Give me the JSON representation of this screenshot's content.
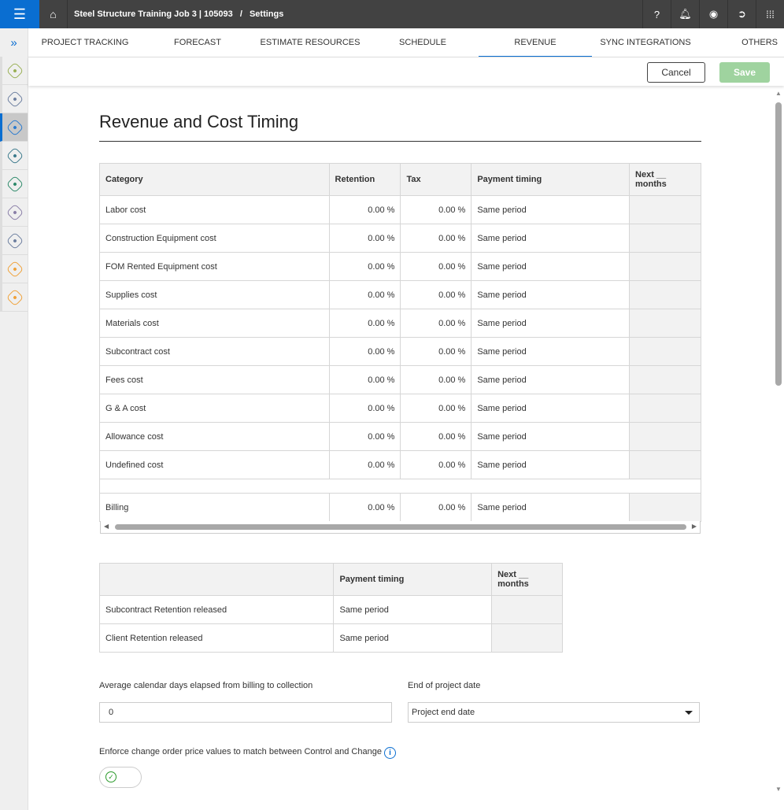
{
  "header": {
    "breadcrumb_project": "Steel Structure Training Job 3 | 105093",
    "breadcrumb_sep": "/",
    "breadcrumb_page": "Settings"
  },
  "tabs": [
    "PROJECT TRACKING",
    "FORECAST",
    "ESTIMATE RESOURCES",
    "SCHEDULE",
    "REVENUE",
    "SYNC INTEGRATIONS",
    "OTHERS"
  ],
  "toolbar": {
    "cancel": "Cancel",
    "save": "Save"
  },
  "page_title": "Revenue and Cost Timing",
  "table1": {
    "headers": [
      "Category",
      "Retention",
      "Tax",
      "Payment timing",
      "Next __ months"
    ],
    "rows": [
      [
        "Labor cost",
        "0.00 %",
        "0.00 %",
        "Same period"
      ],
      [
        "Construction Equipment cost",
        "0.00 %",
        "0.00 %",
        "Same period"
      ],
      [
        "FOM Rented Equipment cost",
        "0.00 %",
        "0.00 %",
        "Same period"
      ],
      [
        "Supplies cost",
        "0.00 %",
        "0.00 %",
        "Same period"
      ],
      [
        "Materials cost",
        "0.00 %",
        "0.00 %",
        "Same period"
      ],
      [
        "Subcontract cost",
        "0.00 %",
        "0.00 %",
        "Same period"
      ],
      [
        "Fees cost",
        "0.00 %",
        "0.00 %",
        "Same period"
      ],
      [
        "G & A cost",
        "0.00 %",
        "0.00 %",
        "Same period"
      ],
      [
        "Allowance cost",
        "0.00 %",
        "0.00 %",
        "Same period"
      ],
      [
        "Undefined cost",
        "0.00 %",
        "0.00 %",
        "Same period"
      ]
    ],
    "billing": [
      "Billing",
      "0.00 %",
      "0.00 %",
      "Same period"
    ]
  },
  "table2": {
    "headers": [
      "",
      "Payment timing",
      "Next __ months"
    ],
    "rows": [
      [
        "Subcontract Retention released",
        "Same period"
      ],
      [
        "Client Retention released",
        "Same period"
      ]
    ]
  },
  "form": {
    "avg_days_label": "Average calendar days elapsed from billing to collection",
    "avg_days_value": "0",
    "end_date_label": "End of project date",
    "end_date_value": "Project end date",
    "enforce_label": "Enforce change order price values to match between Control and Change",
    "enforce_on": true
  },
  "colors": {
    "accent": "#0a6ed1",
    "topbar": "#424242",
    "save_disabled": "#9fd39f"
  }
}
